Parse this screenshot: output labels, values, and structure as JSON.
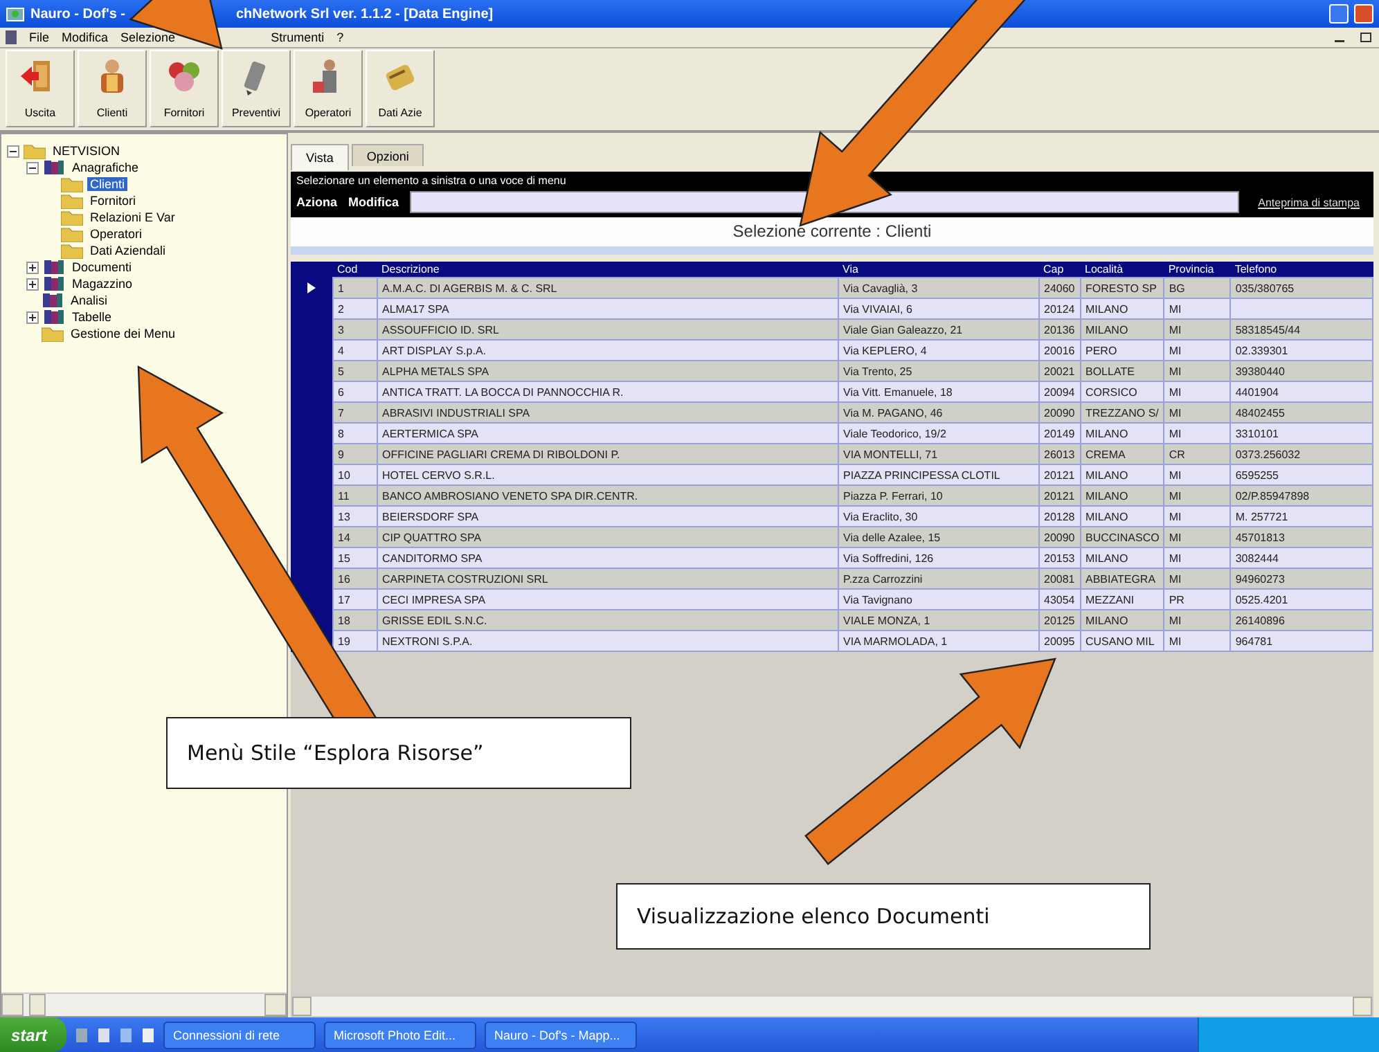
{
  "window": {
    "title_start": "Nauro - Dof's -",
    "title_end": "chNetwork Srl ver. 1.1.2 - [Data Engine]"
  },
  "menu": [
    "File",
    "Modifica",
    "Selezione",
    "Strumenti",
    "?"
  ],
  "toolbar": [
    {
      "label": "Uscita",
      "kind": "exit"
    },
    {
      "label": "Clienti",
      "kind": "person"
    },
    {
      "label": "Fornitori",
      "kind": "people"
    },
    {
      "label": "Preventivi",
      "kind": "pen"
    },
    {
      "label": "Operatori",
      "kind": "worker"
    },
    {
      "label": "Dati Azie",
      "kind": "scroll"
    }
  ],
  "tree": [
    {
      "label": "NETVISION",
      "kind": "folder",
      "expanded": true,
      "selected": false,
      "children": [
        {
          "label": "Anagrafiche",
          "kind": "group",
          "expanded": true,
          "selected": false,
          "children": [
            {
              "label": "Clienti",
              "kind": "folder",
              "selected": true
            },
            {
              "label": "Fornitori",
              "kind": "folder",
              "selected": false
            },
            {
              "label": "Relazioni E Var",
              "kind": "folder",
              "selected": false
            },
            {
              "label": "Operatori",
              "kind": "folder",
              "selected": false
            },
            {
              "label": "Dati Aziendali",
              "kind": "folder",
              "selected": false
            }
          ]
        },
        {
          "label": "Documenti",
          "kind": "group",
          "expanded": false,
          "selected": false
        },
        {
          "label": "Magazzino",
          "kind": "group",
          "expanded": false,
          "selected": false
        },
        {
          "label": "Analisi",
          "kind": "group",
          "selected": false
        },
        {
          "label": "Tabelle",
          "kind": "group",
          "expanded": false,
          "selected": false
        },
        {
          "label": "Gestione dei Menu",
          "kind": "folder",
          "selected": false
        }
      ]
    }
  ],
  "tabs": [
    {
      "label": "Vista",
      "selected": true
    },
    {
      "label": "Opzioni",
      "selected": false
    }
  ],
  "hint": "Selezionare un elemento a sinistra o una voce di menu",
  "actions": {
    "action_label": "Aziona",
    "edit_label": "Modifica",
    "print_link": "Anteprima di stampa"
  },
  "current_selection": "Selezione corrente : Clienti",
  "table": {
    "columns": [
      "Cod",
      "Descrizione",
      "Via",
      "Cap",
      "Località",
      "Provincia",
      "Telefono"
    ],
    "rows": [
      {
        "current": true,
        "cells": [
          "1",
          "A.M.A.C. DI AGERBIS M. & C. SRL",
          "Via Cavaglià, 3",
          "24060",
          "FORESTO SP",
          "BG",
          "035/380765"
        ]
      },
      {
        "current": false,
        "cells": [
          "2",
          "ALMA17 SPA",
          "Via VIVAIAI, 6",
          "20124",
          "MILANO",
          "MI",
          ""
        ]
      },
      {
        "current": false,
        "cells": [
          "3",
          "ASSOUFFICIO ID. SRL",
          "Viale Gian Galeazzo, 21",
          "20136",
          "MILANO",
          "MI",
          "58318545/44"
        ]
      },
      {
        "current": false,
        "cells": [
          "4",
          "ART DISPLAY S.p.A.",
          "Via KEPLERO, 4",
          "20016",
          "PERO",
          "MI",
          "02.339301"
        ]
      },
      {
        "current": false,
        "cells": [
          "5",
          "ALPHA METALS SPA",
          "Via Trento, 25",
          "20021",
          "BOLLATE",
          "MI",
          "39380440"
        ]
      },
      {
        "current": false,
        "cells": [
          "6",
          "ANTICA TRATT. LA BOCCA DI PANNOCCHIA R.",
          "Via Vitt. Emanuele, 18",
          "20094",
          "CORSICO",
          "MI",
          "4401904"
        ]
      },
      {
        "current": false,
        "cells": [
          "7",
          "ABRASIVI INDUSTRIALI SPA",
          "Via M. PAGANO, 46",
          "20090",
          "TREZZANO S/",
          "MI",
          "48402455"
        ]
      },
      {
        "current": false,
        "cells": [
          "8",
          "AERTERMICA SPA",
          "Viale Teodorico, 19/2",
          "20149",
          "MILANO",
          "MI",
          "3310101"
        ]
      },
      {
        "current": false,
        "cells": [
          "9",
          "OFFICINE PAGLIARI CREMA DI RIBOLDONI P.",
          "VIA MONTELLI, 71",
          "26013",
          "CREMA",
          "CR",
          "0373.256032"
        ]
      },
      {
        "current": false,
        "cells": [
          "10",
          "HOTEL CERVO S.R.L.",
          "PIAZZA PRINCIPESSA CLOTIL",
          "20121",
          "MILANO",
          "MI",
          "6595255"
        ]
      },
      {
        "current": false,
        "cells": [
          "11",
          "BANCO AMBROSIANO VENETO SPA DIR.CENTR.",
          "Piazza P. Ferrari, 10",
          "20121",
          "MILANO",
          "MI",
          "02/P.85947898"
        ]
      },
      {
        "current": false,
        "cells": [
          "13",
          "BEIERSDORF SPA",
          "Via Eraclito, 30",
          "20128",
          "MILANO",
          "MI",
          "M. 257721"
        ]
      },
      {
        "current": false,
        "cells": [
          "14",
          "CIP QUATTRO SPA",
          "Via delle Azalee, 15",
          "20090",
          "BUCCINASCO",
          "MI",
          "45701813"
        ]
      },
      {
        "current": false,
        "cells": [
          "15",
          "CANDITORMO SPA",
          "Via Soffredini, 126",
          "20153",
          "MILANO",
          "MI",
          "3082444"
        ]
      },
      {
        "current": false,
        "cells": [
          "16",
          "CARPINETA COSTRUZIONI SRL",
          "P.zza Carrozzini",
          "20081",
          "ABBIATEGRA",
          "MI",
          "94960273"
        ]
      },
      {
        "current": false,
        "cells": [
          "17",
          "CECI IMPRESA SPA",
          "Via Tavignano",
          "43054",
          "MEZZANI",
          "PR",
          "0525.4201"
        ]
      },
      {
        "current": false,
        "cells": [
          "18",
          "GRISSE EDIL S.N.C.",
          "VIALE MONZA, 1",
          "20125",
          "MILANO",
          "MI",
          "26140896"
        ]
      },
      {
        "current": false,
        "cells": [
          "19",
          "NEXTRONI S.P.A.",
          "VIA MARMOLADA, 1",
          "20095",
          "CUSANO MIL",
          "MI",
          "964781"
        ]
      }
    ]
  },
  "taskbar": {
    "start": "start",
    "tasks": [
      "Connessioni di rete",
      "Microsoft Photo Edit...",
      "Nauro - Dof's - Mapp..."
    ]
  },
  "callouts": [
    {
      "text": "Menù Stile “Esplora Risorse”"
    },
    {
      "text": "Visualizzazione elenco Documenti"
    }
  ]
}
